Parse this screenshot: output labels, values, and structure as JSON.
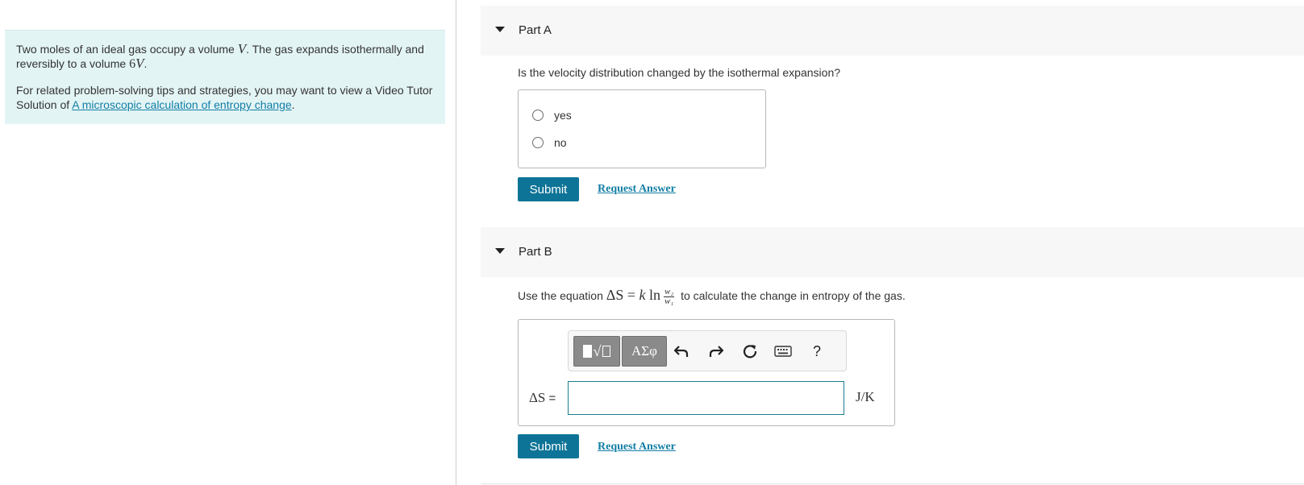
{
  "intro": {
    "line1_pre": "Two moles of an ideal gas occupy a volume ",
    "line1_var": "V",
    "line1_post": ". The gas expands isothermally and reversibly to a volume ",
    "line1_val": "6",
    "line1_var2": "V",
    "line1_end": ".",
    "line2_pre": "For related problem-solving tips and strategies, you may want to view a Video Tutor Solution of ",
    "line2_link": "A microscopic calculation of entropy change",
    "line2_end": "."
  },
  "part_a": {
    "title": "Part A",
    "question": "Is the velocity distribution changed by the isothermal expansion?",
    "options": [
      "yes",
      "no"
    ],
    "submit_label": "Submit",
    "request_label": "Request Answer"
  },
  "part_b": {
    "title": "Part B",
    "question_pre": "Use the equation ",
    "eq_delta_s": "ΔS",
    "eq_eq": " = ",
    "eq_k": "k",
    "eq_ln": " ln",
    "eq_num": "w₂",
    "eq_den": "w₁",
    "question_post": " to calculate the change in entropy of the gas.",
    "answer_label_var": "ΔS",
    "answer_label_eq": " =",
    "answer_value": "",
    "unit": "J/K",
    "toolbar": {
      "greek_label": "ΑΣφ",
      "help_label": "?",
      "icons": [
        "templates-icon",
        "greek-icon",
        "undo-icon",
        "redo-icon",
        "reset-icon",
        "keyboard-icon",
        "help-icon"
      ]
    },
    "submit_label": "Submit",
    "request_label": "Request Answer"
  },
  "colors": {
    "intro_bg": "#e3f4f5",
    "button": "#0e7497",
    "link": "#127ea5",
    "header_bg": "#f7f7f7"
  }
}
